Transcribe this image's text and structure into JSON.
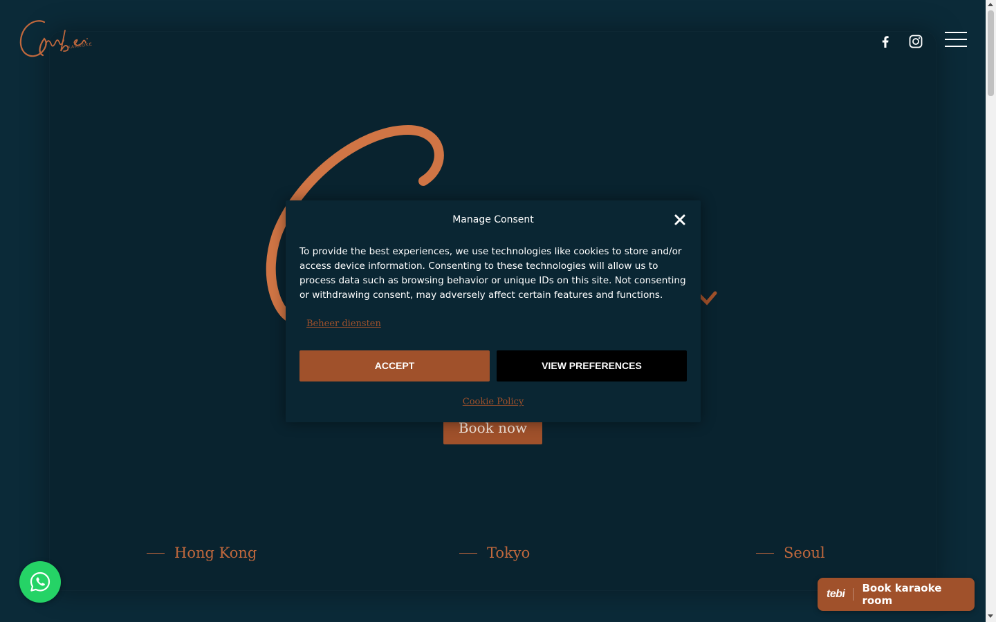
{
  "brand": {
    "logo_sub": "KARAOKE"
  },
  "header": {
    "social": [
      "facebook-icon",
      "instagram-icon"
    ],
    "menu_icon": "hamburger-icon"
  },
  "hero": {
    "book_now_label": "Book now"
  },
  "cities": [
    "Hong Kong",
    "Tokyo",
    "Seoul"
  ],
  "consent": {
    "title": "Manage Consent",
    "body": "To provide the best experiences, we use technologies like cookies to store and/or access device information. Consenting to these technologies will allow us to process data such as browsing behavior or unique IDs on this site. Not consenting or withdrawing consent, may adversely affect certain features and functions.",
    "manage_link": "Beheer diensten",
    "accept_label": "ACCEPT",
    "preferences_label": "VIEW PREFERENCES",
    "cookie_policy_label": "Cookie Policy"
  },
  "widgets": {
    "whatsapp_icon": "whatsapp-icon",
    "tebi_logo": "tebi",
    "tebi_label": "Book karaoke room"
  },
  "colors": {
    "background": "#0b2a38",
    "accent": "#a0512b",
    "accent_light": "#c0683d",
    "whatsapp": "#25d366"
  }
}
